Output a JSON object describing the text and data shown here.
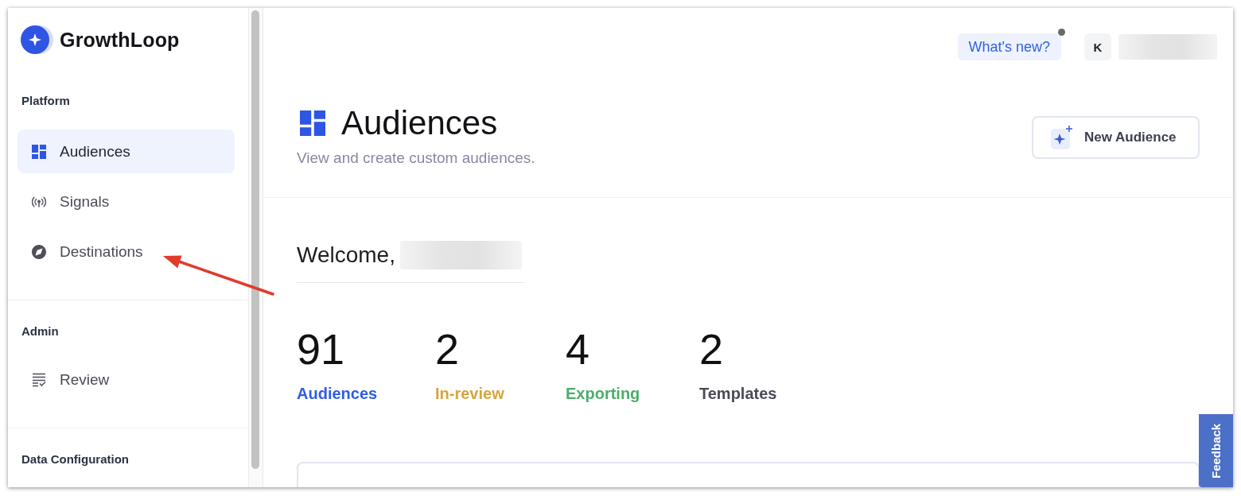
{
  "sidebar": {
    "brand": "GrowthLoop",
    "sections": [
      {
        "title": "Platform",
        "items": [
          {
            "label": "Audiences",
            "selected": true
          },
          {
            "label": "Signals",
            "selected": false
          },
          {
            "label": "Destinations",
            "selected": false
          }
        ]
      },
      {
        "title": "Admin",
        "items": [
          {
            "label": "Review",
            "selected": false
          }
        ]
      },
      {
        "title": "Data Configuration"
      }
    ]
  },
  "top_bar": {
    "whats_new": {
      "label": "What's new?",
      "unread": true
    },
    "avatar": "K"
  },
  "header": {
    "title": "Audiences",
    "subtitle": "View and create custom audiences.",
    "new_button": "New Audience"
  },
  "welcome": {
    "greeting": "Welcome,"
  },
  "stats": [
    {
      "count": "91",
      "label": "Audiences",
      "color": "#2f5ce6"
    },
    {
      "count": "2",
      "label": "In-review",
      "color": "#d6a53d"
    },
    {
      "count": "4",
      "label": "Exporting",
      "color": "#4cae6a"
    },
    {
      "count": "2",
      "label": "Templates",
      "color": "#4a4a56"
    }
  ],
  "feedback_tab": "Feedback"
}
